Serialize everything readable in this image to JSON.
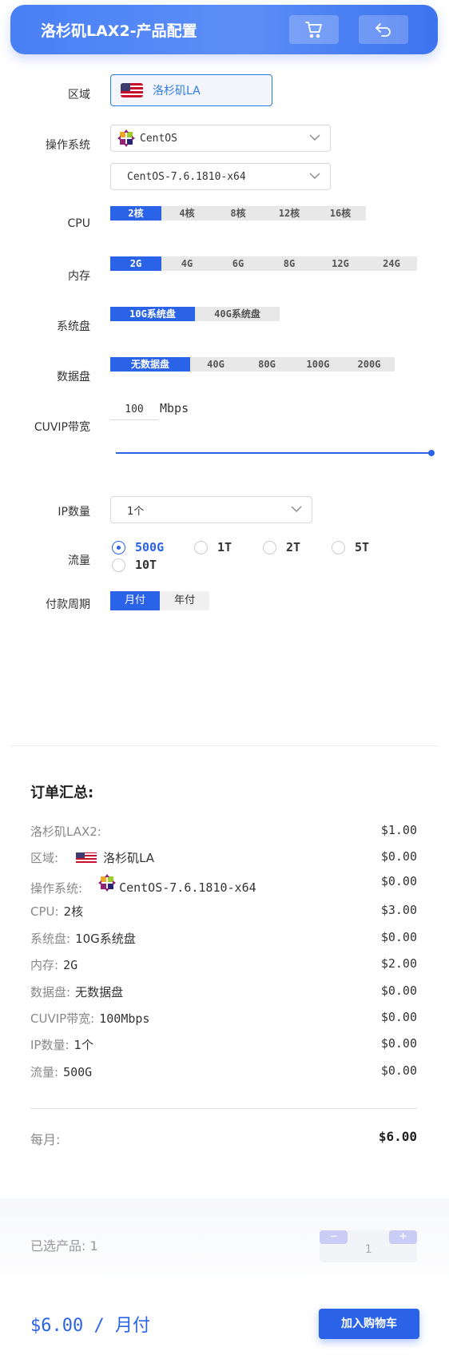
{
  "header": {
    "title": "洛杉矶LAX2-产品配置",
    "cart_icon": "cart-icon",
    "back_icon": "back-arrow-icon"
  },
  "config": {
    "region": {
      "label": "区域",
      "value": "洛杉矶LA",
      "flag": "us-flag-icon"
    },
    "os": {
      "label": "操作系统",
      "family": "CentOS",
      "version": "CentOS-7.6.1810-x64"
    },
    "cpu": {
      "label": "CPU",
      "options": [
        "2核",
        "4核",
        "8核",
        "12核",
        "16核"
      ],
      "selected": 0
    },
    "memory": {
      "label": "内存",
      "options": [
        "2G",
        "4G",
        "6G",
        "8G",
        "12G",
        "24G"
      ],
      "selected": 0
    },
    "system_disk": {
      "label": "系统盘",
      "options": [
        "10G系统盘",
        "40G系统盘"
      ],
      "selected": 0
    },
    "data_disk": {
      "label": "数据盘",
      "options": [
        "无数据盘",
        "40G",
        "80G",
        "100G",
        "200G"
      ],
      "selected": 0
    },
    "bandwidth": {
      "label": "CUVIP带宽",
      "value": "100",
      "unit": "Mbps",
      "slider_level": 1.0
    },
    "ip_count": {
      "label": "IP数量",
      "value": "1个"
    },
    "traffic": {
      "label": "流量",
      "options": [
        "500G",
        "1T",
        "2T",
        "5T",
        "10T"
      ],
      "selected": 0
    },
    "billing": {
      "label": "付款周期",
      "options": [
        "月付",
        "年付"
      ],
      "selected": 0
    }
  },
  "summary": {
    "title": "订单汇总:",
    "rows": [
      {
        "key": "洛杉矶LAX2:",
        "value": "",
        "price": "$1.00"
      },
      {
        "key": "区域:",
        "value": "洛杉矶LA",
        "price": "$0.00"
      },
      {
        "key": "操作系统:",
        "value": "CentOS-7.6.1810-x64",
        "price": "$0.00"
      },
      {
        "key": "CPU:",
        "value": "2核",
        "price": "$3.00"
      },
      {
        "key": "系统盘:",
        "value": "10G系统盘",
        "price": "$0.00"
      },
      {
        "key": "内存:",
        "value": "2G",
        "price": "$2.00"
      },
      {
        "key": "数据盘:",
        "value": "无数据盘",
        "price": "$0.00"
      },
      {
        "key": "CUVIP带宽:",
        "value": "100Mbps",
        "price": "$0.00"
      },
      {
        "key": "IP数量:",
        "value": "1个",
        "price": "$0.00"
      },
      {
        "key": "流量:",
        "value": "500G",
        "price": "$0.00"
      }
    ],
    "total_label": "每月:",
    "total_price": "$6.00"
  },
  "footer": {
    "selected_label": "已选产品: 1",
    "quantity": "1",
    "minus": "−",
    "plus": "+",
    "price_line": "$6.00 / 月付",
    "add_to_cart": "加入购物车"
  },
  "colors": {
    "accent": "#2b63e8",
    "header_gradient": "#4a80f5",
    "link": "#2d7be5"
  }
}
